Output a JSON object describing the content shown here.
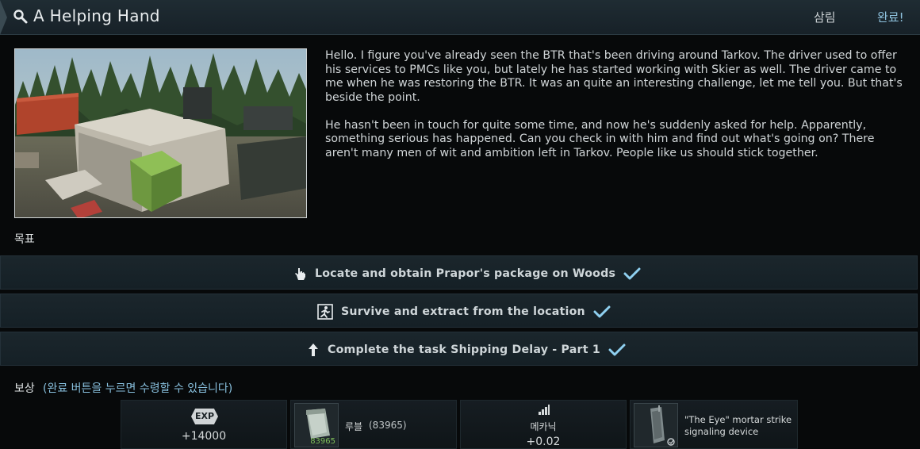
{
  "header": {
    "title": "A Helping Hand",
    "farewell_label": "삼림",
    "complete_label": "완료!"
  },
  "description": {
    "paragraphs": [
      "Hello. I figure you've already seen the BTR that's been driving around Tarkov. The driver used to offer his services to PMCs like you, but lately he has started working with Skier as well. The driver came to me when he was restoring the BTR. It was an quite an interesting challenge, let me tell you. But that's beside the point.",
      "He hasn't been in touch for quite some time, and now he's suddenly asked for help. Apparently, something serious has happened. Can you check in with him and find out what's going on? There aren't many men of wit and ambition left in Tarkov. People like us should stick together."
    ]
  },
  "objectives": {
    "heading": "목표",
    "items": [
      {
        "label": "Locate and obtain Prapor's package on Woods",
        "icon": "hand-icon",
        "done": true
      },
      {
        "label": "Survive and extract from the location",
        "icon": "exit-icon",
        "done": true
      },
      {
        "label": "Complete the task Shipping Delay - Part 1",
        "icon": "arrow-up-icon",
        "done": true
      }
    ]
  },
  "rewards": {
    "heading": "보상",
    "hint": "(완료 버튼을 누르면 수령할 수 있습니다)",
    "exp": {
      "badge": "EXP",
      "value": "+14000"
    },
    "roubles": {
      "label": "루블",
      "amount": "(83965)",
      "count": "83965"
    },
    "mechanic": {
      "label": "메카닉",
      "value": "+0.02"
    },
    "item": {
      "name": "\"The Eye\" mortar strike signaling device"
    }
  },
  "colors": {
    "accent": "#8fc3df",
    "check": "#8fd0f0",
    "header_bg": "#1f2c33",
    "objective_bg": "#1b262c"
  }
}
